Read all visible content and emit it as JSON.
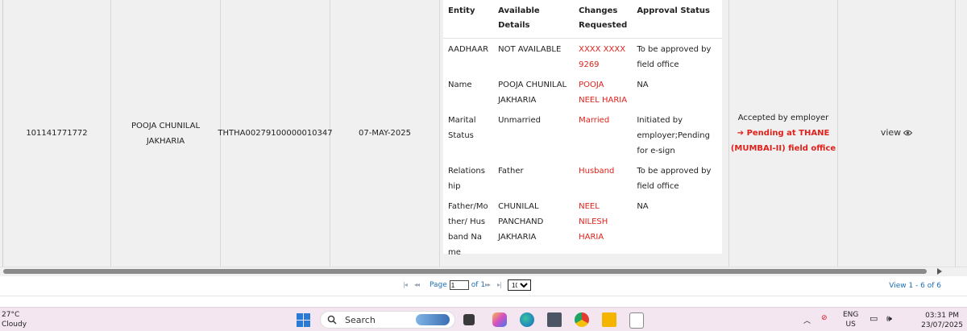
{
  "record": {
    "member_id": "101141771772",
    "name_line1": "POOJA CHUNILAL",
    "name_line2": "JAKHARIA",
    "establishment_id": "THTHA00279100000010347",
    "date": "07-MAY-2025",
    "status_line1": "Accepted by employer",
    "status_line2": "➔ Pending at THANE",
    "status_line3": "(MUMBAI-II) field office",
    "view_label": "view"
  },
  "detail_table": {
    "headers": [
      "Entity",
      "Available Details",
      "Changes Requested",
      "Approval Status"
    ],
    "rows": [
      {
        "entity": "AADHAAR",
        "available": "NOT AVAILABLE",
        "changes": "XXXX XXXX 9269",
        "status": "To be approved by field office"
      },
      {
        "entity": "Name",
        "available": "POOJA CHUNILAL JAKHARIA",
        "changes": "POOJA NEEL HARIA",
        "status": "NA"
      },
      {
        "entity": "Marital Status",
        "available": "Unmarried",
        "changes": "Married",
        "status": "Initiated by employer;Pending for e-sign"
      },
      {
        "entity": "Relationship",
        "available": "Father",
        "changes": "Husband",
        "status": "To be approved by field office"
      },
      {
        "entity": "Father/Mother/ Husband Name",
        "available": "CHUNILAL PANCHAND JAKHARIA",
        "changes": "NEEL NILESH HARIA",
        "status": "NA"
      }
    ]
  },
  "pager": {
    "page_label": "Page",
    "page_value": "1",
    "of_label": "of 1",
    "rows_per_page": "10",
    "view_info": "View 1 - 6 of 6"
  },
  "taskbar": {
    "temperature": "27°C",
    "weather": "Cloudy",
    "search_placeholder": "Search",
    "lang_line1": "ENG",
    "lang_line2": "US",
    "time": "03:31 PM",
    "date": "23/07/2025"
  },
  "colors": {
    "accent_red": "#e0211b",
    "link_blue": "#1a6fb8",
    "taskbar_bg": "#f3e6f1"
  }
}
